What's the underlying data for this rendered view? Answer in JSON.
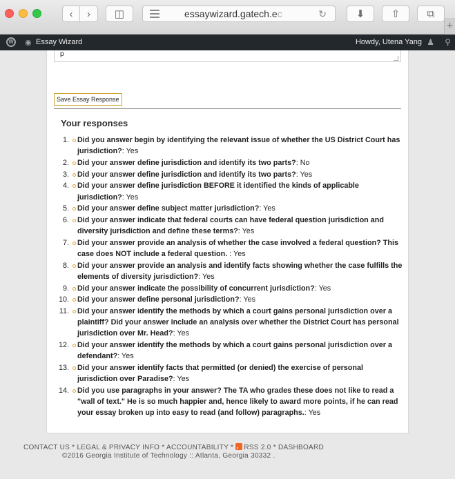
{
  "browser": {
    "url": "essaywizard.gatech.e",
    "url_faded": "c"
  },
  "admin_bar": {
    "site_name": "Essay Wizard",
    "greeting": "Howdy, Utena Yang"
  },
  "essay": {
    "textarea_value": "p",
    "save_label": "Save Essay Response"
  },
  "responses": {
    "title": "Your responses",
    "items": [
      {
        "num": "1.",
        "question": "Did you answer begin by identifying the relevant issue of whether the US District Court has jurisdiction?",
        "answer": ": Yes"
      },
      {
        "num": "2.",
        "question": "Did your answer define jurisdiction and identify its two parts?",
        "answer": ": No"
      },
      {
        "num": "3.",
        "question": "Did your answer define jurisdiction and identify its two parts?",
        "answer": ": Yes"
      },
      {
        "num": "4.",
        "question": "Did your answer define jurisdiction BEFORE it identified the kinds of applicable jurisdiction?",
        "answer": ": Yes"
      },
      {
        "num": "5.",
        "question": "Did your answer define subject matter jurisdiction?",
        "answer": ": Yes"
      },
      {
        "num": "6.",
        "question": "Did your answer indicate that federal courts can have federal question jurisdiction and diversity jurisdiction and define these terms?",
        "answer": ": Yes"
      },
      {
        "num": "7.",
        "question": "Did your answer provide an analysis of whether the case involved a federal question? This case does NOT include a federal question. ",
        "answer": ": Yes"
      },
      {
        "num": "8.",
        "question": "Did your answer provide an analysis and identify facts showing whether the case fulfills the elements of diversity jurisdiction?",
        "answer": ": Yes"
      },
      {
        "num": "9.",
        "question": "Did your answer indicate the possibility of concurrent jurisdiction?",
        "answer": ": Yes"
      },
      {
        "num": "10.",
        "question": "Did your answer define personal jurisdiction?",
        "answer": ": Yes"
      },
      {
        "num": "11.",
        "question": "Did your answer identify the methods by which a court gains personal jurisdiction over a plaintiff? Did your answer include an analysis over whether the District Court has personal jurisdiction over Mr. Head?",
        "answer": ": Yes"
      },
      {
        "num": "12.",
        "question": "Did your answer identify the methods by which a court gains personal jurisdiction over a defendant?",
        "answer": ": Yes"
      },
      {
        "num": "13.",
        "question": "Did your answer identify facts that permitted (or denied) the exercise of personal jurisdiction over Paradise?",
        "answer": ": Yes"
      },
      {
        "num": "14.",
        "question": "Did you use paragraphs in your answer? The TA who grades these does not like to read a \"wall of text.\" He is so much happier and, hence likely to award more points, if he can read your essay broken up into easy to read (and follow) paragraphs.",
        "answer": ": Yes"
      }
    ]
  },
  "footer": {
    "contact": "CONTACT US",
    "legal": "LEGAL & PRIVACY INFO",
    "accountability": "ACCOUNTABILITY",
    "rss": "RSS 2.0",
    "dashboard": "DASHBOARD",
    "separator": " * ",
    "copyright": "©2016 Georgia Institute of Technology :: Atlanta, Georgia 30332 ."
  },
  "colors": {
    "admin_bar_bg": "#23282d",
    "save_border": "#c9a227",
    "bullet": "#e0a030",
    "rss": "#f26522"
  }
}
